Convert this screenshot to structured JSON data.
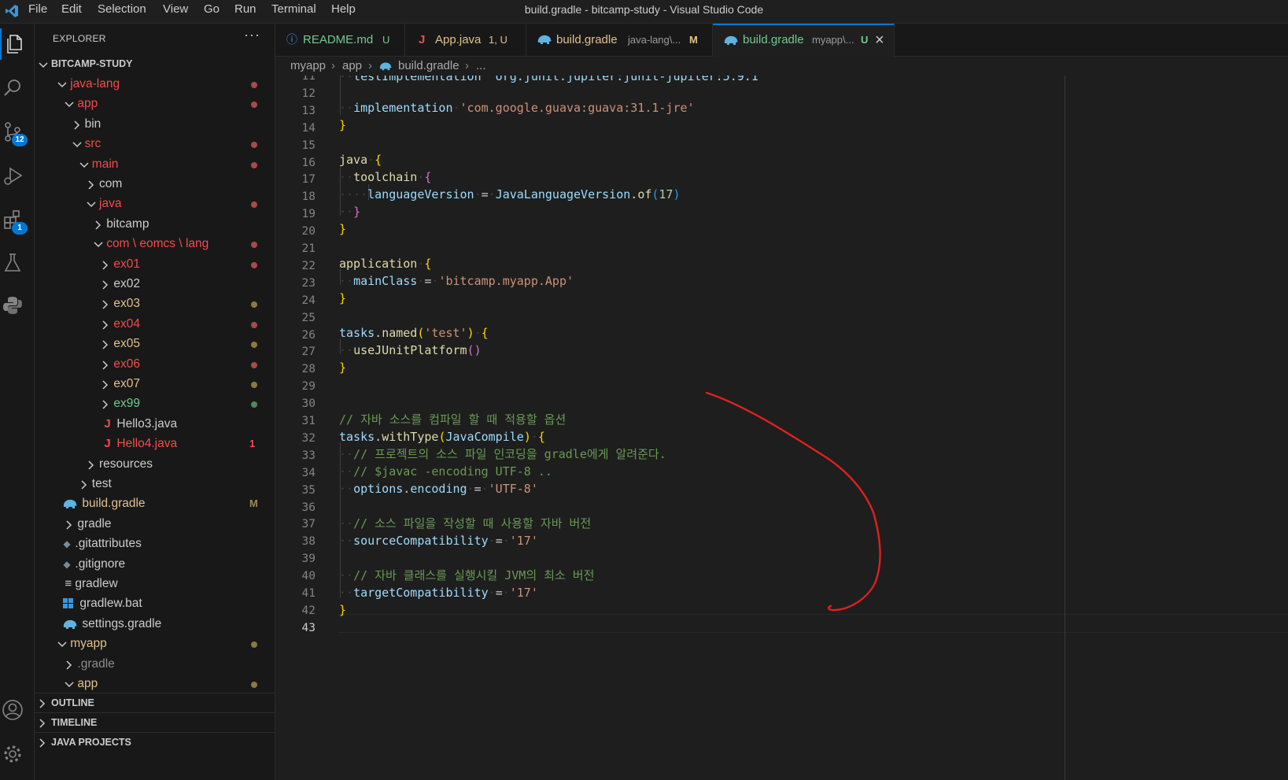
{
  "titlebar": {
    "title": "build.gradle - bitcamp-study - Visual Studio Code",
    "menu": [
      "File",
      "Edit",
      "Selection",
      "View",
      "Go",
      "Run",
      "Terminal",
      "Help"
    ]
  },
  "activity": {
    "scm_badge": "12",
    "extensions_badge": "1"
  },
  "sidebar": {
    "title": "EXPLORER",
    "more": "···",
    "root": "BITCAMP-STUDY",
    "tree": [
      {
        "label": "java-lang",
        "color": "#f14c4c",
        "decoration": "dot",
        "decoration_color": "#a94a4a"
      },
      {
        "label": "app",
        "color": "#f14c4c",
        "decoration": "dot",
        "decoration_color": "#a94a4a"
      },
      {
        "label": "bin",
        "color": "#cccccc"
      },
      {
        "label": "src",
        "color": "#f14c4c",
        "decoration": "dot",
        "decoration_color": "#a94a4a"
      },
      {
        "label": "main",
        "color": "#f14c4c",
        "decoration": "dot",
        "decoration_color": "#a94a4a"
      },
      {
        "label": "com",
        "color": "#cccccc"
      },
      {
        "label": "java",
        "color": "#f14c4c",
        "decoration": "dot",
        "decoration_color": "#a94a4a"
      },
      {
        "label": "bitcamp",
        "color": "#cccccc"
      },
      {
        "label": "com \\ eomcs \\ lang",
        "color": "#f14c4c",
        "decoration": "dot",
        "decoration_color": "#a94a4a"
      },
      {
        "label": "ex01",
        "color": "#f14c4c",
        "decoration": "dot",
        "decoration_color": "#a94a4a"
      },
      {
        "label": "ex02",
        "color": "#cccccc"
      },
      {
        "label": "ex03",
        "color": "#e2c08d",
        "decoration": "dot",
        "decoration_color": "#8a7a3c"
      },
      {
        "label": "ex04",
        "color": "#f14c4c",
        "decoration": "dot",
        "decoration_color": "#a94a4a"
      },
      {
        "label": "ex05",
        "color": "#e2c08d",
        "decoration": "dot",
        "decoration_color": "#8a7a3c"
      },
      {
        "label": "ex06",
        "color": "#f14c4c",
        "decoration": "dot",
        "decoration_color": "#a94a4a"
      },
      {
        "label": "ex07",
        "color": "#e2c08d",
        "decoration": "dot",
        "decoration_color": "#8a7a3c"
      },
      {
        "label": "ex99",
        "color": "#73c991",
        "decoration": "dot",
        "decoration_color": "#4f8a5a"
      },
      {
        "label": "Hello3.java",
        "color": "#cccccc"
      },
      {
        "label": "Hello4.java",
        "color": "#f14c4c",
        "decoration": "mark",
        "mark": "1",
        "decoration_color": "#f14c4c"
      },
      {
        "label": "resources",
        "color": "#cccccc"
      },
      {
        "label": "test",
        "color": "#cccccc"
      },
      {
        "label": "build.gradle",
        "color": "#e2c08d",
        "decoration": "mark",
        "mark": "M",
        "decoration_color": "#9a8a5a"
      },
      {
        "label": "gradle",
        "color": "#cccccc"
      },
      {
        "label": ".gitattributes",
        "color": "#cccccc"
      },
      {
        "label": ".gitignore",
        "color": "#cccccc"
      },
      {
        "label": "gradlew",
        "color": "#cccccc"
      },
      {
        "label": "gradlew.bat",
        "color": "#cccccc"
      },
      {
        "label": "settings.gradle",
        "color": "#cccccc"
      },
      {
        "label": "myapp",
        "color": "#e2c08d",
        "decoration": "dot",
        "decoration_color": "#8a7a3c"
      },
      {
        "label": ".gradle",
        "color": "#8c8c8c"
      },
      {
        "label": "app",
        "color": "#e2c08d",
        "decoration": "dot",
        "decoration_color": "#8a7a3c"
      }
    ],
    "sections": [
      "OUTLINE",
      "TIMELINE",
      "JAVA PROJECTS"
    ]
  },
  "tabs": [
    {
      "label": "README.md",
      "status": "U",
      "status_color": "#73c991",
      "label_color": "#73c991"
    },
    {
      "label": "App.java",
      "desc": "",
      "status": "1, U",
      "status_color": "#e2c08d",
      "label_color": "#e2c08d"
    },
    {
      "label": "build.gradle",
      "desc": "java-lang\\...",
      "status": "M",
      "status_color": "#e2c08d",
      "label_color": "#e2c08d"
    },
    {
      "label": "build.gradle",
      "desc": "myapp\\...",
      "status": "U",
      "status_color": "#73c991",
      "label_color": "#73c991",
      "close": "×"
    }
  ],
  "breadcrumb": [
    "myapp",
    "app",
    "build.gradle",
    "..."
  ],
  "editor": {
    "partial_line": "testImplementation 'org.junit.jupiter:junit-jupiter:5.9.1'",
    "line_numbers": [
      "11",
      "12",
      "13",
      "14",
      "15",
      "16",
      "17",
      "18",
      "19",
      "20",
      "21",
      "22",
      "23",
      "24",
      "25",
      "26",
      "27",
      "28",
      "29",
      "30",
      "31",
      "32",
      "33",
      "34",
      "35",
      "36",
      "37",
      "38",
      "39",
      "40",
      "41",
      "42",
      "43"
    ],
    "current_line": "43",
    "lines": {
      "l13_impl": "implementation",
      "l13_str": "'com.google.guava:guava:31.1-jre'",
      "l16_java": "java",
      "l17_toolchain": "toolchain",
      "l18_lv": "languageVersion",
      "l18_eq": "=",
      "l18_cls": "JavaLanguageVersion",
      "l18_of": "of",
      "l18_num": "17",
      "l22_app": "application",
      "l23_mc": "mainClass",
      "l23_str": "'bitcamp.myapp.App'",
      "l26_tasks": "tasks",
      "l26_named": "named",
      "l26_str": "'test'",
      "l27_use": "useJUnitPlatform",
      "l31_comment": "// 자바 소스를 컴파일 할 때 적용할 옵션",
      "l32_tasks": "tasks",
      "l32_wt": "withType",
      "l32_jc": "JavaCompile",
      "l33_comment": "// 프로젝트의 소스 파일 인코딩을 gradle에게 알려준다.",
      "l34_comment": "// $javac -encoding UTF-8 ..",
      "l35_opt": "options",
      "l35_enc": "encoding",
      "l35_str": "'UTF-8'",
      "l37_comment": "// 소스 파일을 작성할 때 사용할 자바 버전",
      "l38_sc": "sourceCompatibility",
      "l38_str": "'17'",
      "l40_comment": "// 자바 클래스를 실행시킬 JVM의 최소 버전",
      "l41_tc": "targetCompatibility",
      "l41_str": "'17'"
    }
  },
  "colors": {
    "accent": "#0078d4",
    "annotation": "#e02020"
  }
}
